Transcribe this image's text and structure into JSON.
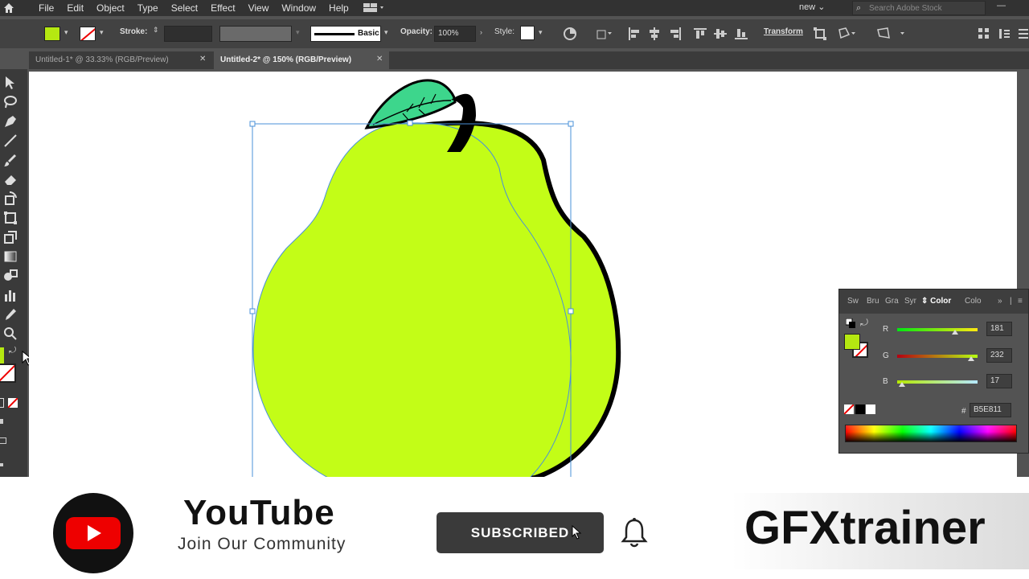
{
  "menu": {
    "items": [
      "File",
      "Edit",
      "Object",
      "Type",
      "Select",
      "Effect",
      "View",
      "Window",
      "Help"
    ],
    "workspace": "new",
    "search_placeholder": "Search Adobe Stock"
  },
  "control": {
    "fill_color": "#B5E811",
    "stroke_label": "Stroke:",
    "brush_label": "Basic",
    "opacity_label": "Opacity:",
    "opacity_value": "100%",
    "style_label": "Style:",
    "transform_label": "Transform"
  },
  "tabs": [
    {
      "label": "Untitled-1* @ 33.33% (RGB/Preview)",
      "active": false
    },
    {
      "label": "Untitled-2* @ 150% (RGB/Preview)",
      "active": true
    }
  ],
  "color_panel": {
    "tabs": [
      "Sw",
      "Bru",
      "Gra",
      "Syr",
      "Color",
      "Colo"
    ],
    "active_tab": "Color",
    "r_label": "R",
    "r_value": "181",
    "g_label": "G",
    "g_value": "232",
    "b_label": "B",
    "b_value": "17",
    "hash": "#",
    "hex": "B5E811"
  },
  "banner": {
    "title": "YouTube",
    "subtitle": "Join Our Community",
    "subscribe": "SUBSCRIBED",
    "brand": "GFXtrainer"
  },
  "colors": {
    "pear": "#C3FD17",
    "leaf": "#3DD68C",
    "selection": "#4A90D9"
  }
}
